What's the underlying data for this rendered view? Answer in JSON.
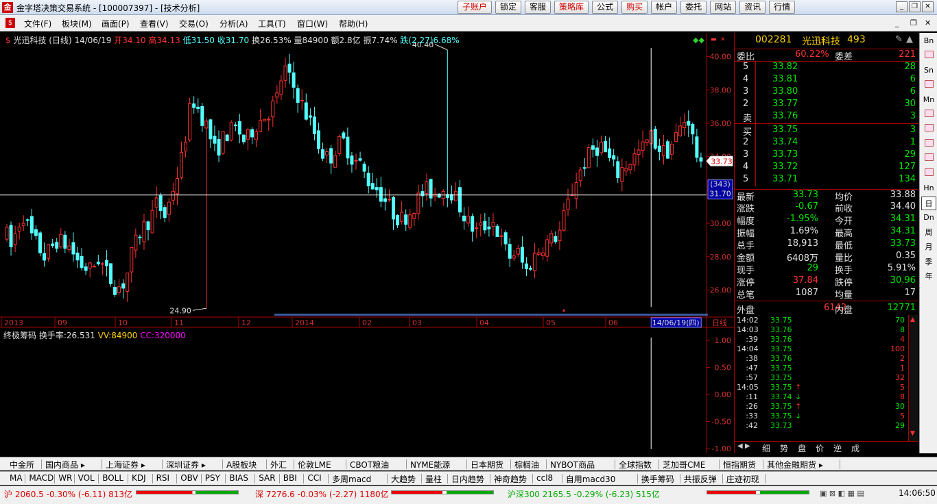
{
  "window": {
    "title": "金字塔决策交易系统 - [100007397] - [技术分析]",
    "icon": "app-icon"
  },
  "toolbar_buttons": [
    {
      "label": "子账户",
      "red": true
    },
    {
      "label": "锁定",
      "red": false
    },
    {
      "label": "客服",
      "red": false
    },
    {
      "label": "策略库",
      "red": true
    },
    {
      "label": "公式",
      "red": false
    },
    {
      "label": "购买",
      "red": true
    },
    {
      "label": "帐户",
      "red": false
    },
    {
      "label": "委托",
      "red": false
    },
    {
      "label": "网站",
      "red": false
    },
    {
      "label": "资讯",
      "red": false
    },
    {
      "label": "行情",
      "red": false
    }
  ],
  "menu": [
    "文件(F)",
    "板块(M)",
    "画面(P)",
    "查看(V)",
    "交易(O)",
    "分析(A)",
    "工具(T)",
    "窗口(W)",
    "帮助(H)"
  ],
  "chart_header": {
    "name": "光迅科技 (日线) 14/06/19",
    "open": "开34.10",
    "high": "高34.13",
    "low": "低31.50",
    "close": "收31.70",
    "turnover": "换26.53%",
    "volume": "量84900",
    "amount": "额2.8亿",
    "amplitude": "振7.74%",
    "change": "跌(2.27)6.68%"
  },
  "indicator_header": {
    "name": "终极筹码",
    "turnover": "换手率:26.531",
    "vv": "VV:84900",
    "cc": "CC:320000"
  },
  "price_axis": [
    "40.00",
    "38.00",
    "36.00",
    "34.00",
    "32.00",
    "30.00",
    "28.00",
    "26.00"
  ],
  "indicator_axis": [
    "1.00",
    "0.50",
    "0.00",
    "-0.50",
    "-1.00"
  ],
  "time_axis": [
    "2013",
    "09",
    "10",
    "11",
    "12",
    "2014",
    "02",
    "03",
    "04",
    "05",
    "06"
  ],
  "period_label": "日线",
  "cursor": {
    "date": "14/06/19(四)",
    "price": "31.70",
    "count": "(343)"
  },
  "current_price_tag": "33.73",
  "annotations": {
    "high": "40.40",
    "low": "24.90"
  },
  "chart_data": {
    "type": "candlestick",
    "ylim": [
      24.5,
      40.6
    ],
    "high": 40.4,
    "low": 24.9,
    "last": 33.73,
    "cursor_price": 31.7
  },
  "quote": {
    "code": "002281",
    "name": "光迅科技",
    "num": "493",
    "weibi_label": "委比",
    "weibi": "60.22%",
    "weicha_label": "委差",
    "weicha": "221",
    "sell": [
      {
        "lvl": "5",
        "p": "33.82",
        "v": "28"
      },
      {
        "lvl": "4",
        "p": "33.81",
        "v": "6"
      },
      {
        "lvl": "3",
        "p": "33.80",
        "v": "6"
      },
      {
        "lvl": "2",
        "p": "33.77",
        "v": "30"
      },
      {
        "lvl": "卖",
        "p": "33.76",
        "v": "3"
      }
    ],
    "buy": [
      {
        "lvl": "买",
        "p": "33.75",
        "v": "3"
      },
      {
        "lvl": "2",
        "p": "33.74",
        "v": "1"
      },
      {
        "lvl": "3",
        "p": "33.73",
        "v": "29"
      },
      {
        "lvl": "4",
        "p": "33.72",
        "v": "127"
      },
      {
        "lvl": "5",
        "p": "33.71",
        "v": "134"
      }
    ],
    "stats": [
      {
        "l1": "最新",
        "v1": "33.73",
        "c1": "grn",
        "l2": "均价",
        "v2": "33.88",
        "c2": "wht"
      },
      {
        "l1": "涨跌",
        "v1": "-0.67",
        "c1": "grn",
        "l2": "前收",
        "v2": "34.40",
        "c2": "wht"
      },
      {
        "l1": "幅度",
        "v1": "-1.95%",
        "c1": "grn",
        "l2": "今开",
        "v2": "34.31",
        "c2": "grn"
      },
      {
        "l1": "振幅",
        "v1": "1.69%",
        "c1": "wht",
        "l2": "最高",
        "v2": "34.31",
        "c2": "grn"
      },
      {
        "l1": "总手",
        "v1": "18,913",
        "c1": "wht",
        "l2": "最低",
        "v2": "33.73",
        "c2": "grn"
      },
      {
        "l1": "金额",
        "v1": "6408万",
        "c1": "wht",
        "l2": "量比",
        "v2": "0.35",
        "c2": "wht"
      },
      {
        "l1": "现手",
        "v1": "29",
        "c1": "grn",
        "l2": "换手",
        "v2": "5.91%",
        "c2": "wht"
      },
      {
        "l1": "涨停",
        "v1": "37.84",
        "c1": "red",
        "l2": "跌停",
        "v2": "30.96",
        "c2": "grn"
      },
      {
        "l1": "总笔",
        "v1": "1087",
        "c1": "wht",
        "l2": "均量",
        "v2": "17",
        "c2": "wht"
      }
    ],
    "outer_label": "外盘",
    "outer": "6142",
    "inner_label": "内盘",
    "inner": "12771"
  },
  "ticks": [
    {
      "t": "14:02",
      "p": "33.75",
      "a": "",
      "v": "70"
    },
    {
      "t": "14:03",
      "p": "33.76",
      "a": "",
      "v": "8"
    },
    {
      "t": ":39",
      "p": "33.76",
      "a": "",
      "v": "4"
    },
    {
      "t": "14:04",
      "p": "33.75",
      "a": "",
      "v": "100"
    },
    {
      "t": ":38",
      "p": "33.76",
      "a": "",
      "v": "2"
    },
    {
      "t": ":47",
      "p": "33.75",
      "a": "",
      "v": "1"
    },
    {
      "t": ":57",
      "p": "33.75",
      "a": "",
      "v": "32"
    },
    {
      "t": "14:05",
      "p": "33.75",
      "a": "↑",
      "v": "5"
    },
    {
      "t": ":11",
      "p": "33.74",
      "a": "↓",
      "v": "8"
    },
    {
      "t": ":26",
      "p": "33.75",
      "a": "↑",
      "v": "30"
    },
    {
      "t": ":33",
      "p": "33.75",
      "a": "↓",
      "v": "5"
    },
    {
      "t": ":42",
      "p": "33.73",
      "a": "",
      "v": "29"
    }
  ],
  "ticks_tabs": [
    "细",
    "势",
    "盘",
    "价",
    "逆",
    "成"
  ],
  "side_tools": [
    "Bn",
    "",
    "Sn",
    "",
    "Mn",
    "",
    "",
    "",
    "",
    "",
    "Hn",
    "日",
    "Dn",
    "周",
    "月",
    "季",
    "年"
  ],
  "market_tabs": [
    "中金所",
    "国内商品 ▸",
    "上海证券 ▸",
    "深圳证券 ▸",
    "A股板块",
    "外汇",
    "伦敦LME",
    "CBOT粮油",
    "NYME能源",
    "日本期货",
    "棕榈油",
    "NYBOT商品",
    "全球指数",
    "芝加哥CME",
    "恒指期货",
    "其他金融期货 ▸"
  ],
  "indicator_tabs": [
    "MA",
    "MACD",
    "WR",
    "VOL",
    "BOLL",
    "KDJ",
    "RSI",
    "OBV",
    "PSY",
    "BIAS",
    "SAR",
    "BBI",
    "CCI",
    "多周macd",
    "大趋势",
    "量柱",
    "日内趋势",
    "神奇趋势",
    "ccl8",
    "自用macd30",
    "换手筹码",
    "共振反弹",
    "庄迹初现"
  ],
  "status": {
    "sh": "沪 2060.5 -0.30% (-6.11) 813亿",
    "sz": "深 7276.6 -0.03% (-2.27) 1180亿",
    "hs": "沪深300 2165.5 -0.29% (-6.23) 515亿",
    "time": "14:06:50"
  }
}
